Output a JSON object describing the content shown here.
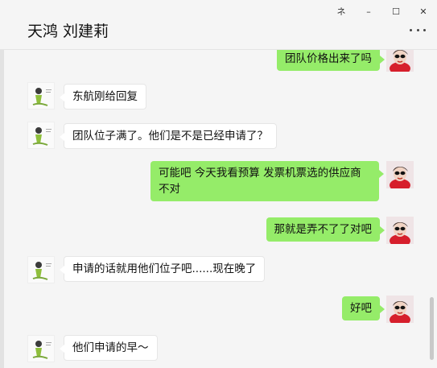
{
  "window": {
    "controls": {
      "pin": "ネ",
      "minimize": "–",
      "maximize": "☐",
      "close": "✕"
    }
  },
  "header": {
    "title": "天鸿 刘建莉"
  },
  "messages": [
    {
      "side": "out",
      "text": "团队价格出来了吗"
    },
    {
      "side": "in",
      "text": "东航刚给回复"
    },
    {
      "side": "in",
      "text": "团队位子满了。他们是不是已经申请了？"
    },
    {
      "side": "out",
      "text": "可能吧  今天我看预算 发票机票选的供应商不对"
    },
    {
      "side": "out",
      "text": "那就是弄不了了对吧"
    },
    {
      "side": "in",
      "text": "申请的话就用他们位子吧......现在晚了"
    },
    {
      "side": "out",
      "text": "好吧"
    },
    {
      "side": "in",
      "text": "他们申请的早～"
    }
  ],
  "colors": {
    "outgoing_bubble": "#95ec69",
    "incoming_bubble": "#ffffff",
    "background": "#f5f5f5"
  }
}
